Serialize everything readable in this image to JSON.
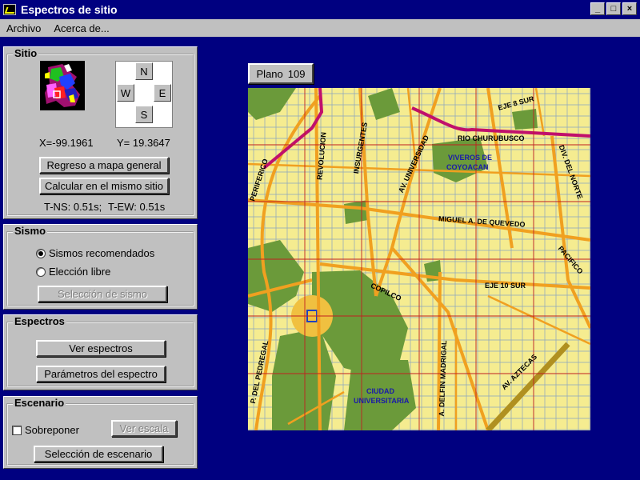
{
  "window": {
    "title": "Espectros de sitio",
    "min": "_",
    "max": "□",
    "close": "×"
  },
  "menu": {
    "archivo": "Archivo",
    "acerca": "Acerca de..."
  },
  "sitio": {
    "title": "Sitio",
    "compass": {
      "n": "N",
      "w": "W",
      "e": "E",
      "s": "S"
    },
    "x_coord": "X=-99.1961",
    "y_coord": "Y= 19.3647",
    "btn_regreso": "Regreso a mapa general",
    "btn_calcular": "Calcular en el mismo sitio",
    "t_ns": "T-NS:  0.51s;",
    "t_ew": "T-EW:  0.51s"
  },
  "sismo": {
    "title": "Sismo",
    "option_recomendados": "Sismos recomendados",
    "option_libre": "Elección libre",
    "selected": "Sismos recomendados",
    "btn_seleccion": "Selección de sismo"
  },
  "espectros": {
    "title": "Espectros",
    "btn_ver": "Ver espectros",
    "btn_parametros": "Parámetros del espectro"
  },
  "escenario": {
    "title": "Escenario",
    "checkbox_sobreponer": "Sobreponer",
    "sobreponer_checked": false,
    "btn_ver_escala": "Ver escala",
    "btn_seleccion": "Selección de escenario"
  },
  "map": {
    "plano_label": "Plano",
    "plano_number": "109",
    "streets": {
      "periferico": "PERIFERICO",
      "revolucion": "REVOLUCION",
      "insurgentes": "INSURGENTES",
      "universidad": "AV. UNIVERSIDAD",
      "churubusco": "RIO CHURUBUSCO",
      "eje8": "EJE 8 SUR",
      "viveros1": "VIVEROS DE",
      "viveros2": "COYOACAN",
      "quevedo": "MIGUEL A. DE QUEVEDO",
      "norte": "DIV. DEL NORTE",
      "pacifico": "PACIFICO",
      "copilco": "COPILCO",
      "eje10": "EJE 10 SUR",
      "pedregal": "P. DEL PEDREGAL",
      "madrigal": "A. DELFIN MADRIGAL",
      "cu1": "CIUDAD",
      "cu2": "UNIVERSITARIA",
      "aztecas": "AV. AZTECAS"
    }
  },
  "colors": {
    "desktop": "#000080",
    "face": "#c0c0c0",
    "map_bg": "#f5ec90",
    "road": "#f0a020",
    "park": "#6b9a3a",
    "highway": "#c0106c"
  }
}
